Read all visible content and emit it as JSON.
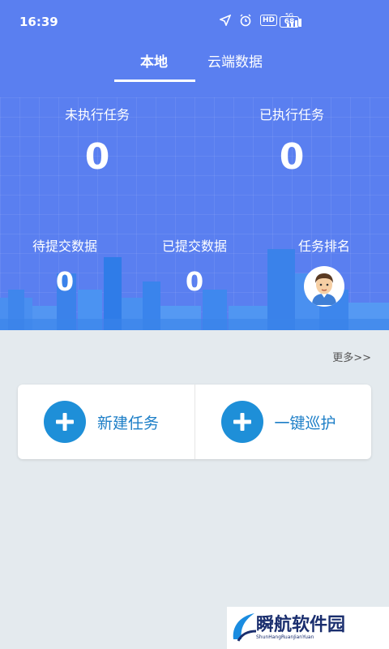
{
  "status_bar": {
    "time": "16:39",
    "network": "5G",
    "hd": "HD",
    "battery": "68"
  },
  "tabs": [
    {
      "label": "本地",
      "active": true
    },
    {
      "label": "云端数据",
      "active": false
    }
  ],
  "stats": {
    "unexecuted": {
      "label": "未执行任务",
      "value": "0"
    },
    "executed": {
      "label": "已执行任务",
      "value": "0"
    },
    "pending_submit": {
      "label": "待提交数据",
      "value": "0"
    },
    "submitted": {
      "label": "已提交数据",
      "value": "0"
    },
    "ranking": {
      "label": "任务排名"
    }
  },
  "more_link": "更多>>",
  "actions": [
    {
      "label": "新建任务",
      "icon": "plus-icon"
    },
    {
      "label": "一键巡护",
      "icon": "plus-icon"
    }
  ],
  "watermark": {
    "title": "瞬航软件园",
    "subtitle": "ShunHangRuanJianYuan"
  },
  "colors": {
    "hero_bg": "#5a7ff0",
    "accent": "#1e8fd8",
    "page_bg": "#e4eaee"
  }
}
